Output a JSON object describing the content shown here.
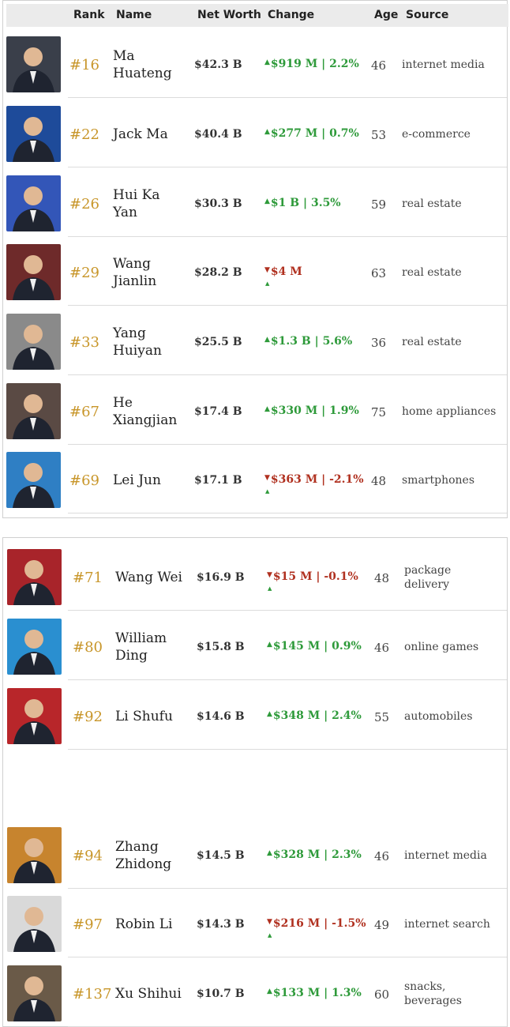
{
  "header": {
    "rank": "Rank",
    "name": "Name",
    "net_worth": "Net Worth",
    "change": "Change",
    "age": "Age",
    "source": "Source"
  },
  "panel1": [
    {
      "rank": "#16",
      "name": [
        "Ma",
        "Huateng"
      ],
      "net_worth": "$42.3 B",
      "change": "$919 M | 2.2%",
      "dir": "up",
      "age": "46",
      "source": [
        "internet media"
      ],
      "photo_color": "#3a3f4a"
    },
    {
      "rank": "#22",
      "name": [
        "Jack Ma"
      ],
      "net_worth": "$40.4 B",
      "change": "$277 M | 0.7%",
      "dir": "up",
      "age": "53",
      "source": [
        "e-commerce"
      ],
      "photo_color": "#1e4b9a"
    },
    {
      "rank": "#26",
      "name": [
        "Hui Ka",
        "Yan"
      ],
      "net_worth": "$30.3 B",
      "change": "$1 B | 3.5%",
      "dir": "up",
      "age": "59",
      "source": [
        "real estate"
      ],
      "photo_color": "#3356b8"
    },
    {
      "rank": "#29",
      "name": [
        "Wang",
        "Jianlin"
      ],
      "net_worth": "$28.2 B",
      "change": "$4 M",
      "dir": "down",
      "age": "63",
      "source": [
        "real estate"
      ],
      "photo_color": "#6e2a2a"
    },
    {
      "rank": "#33",
      "name": [
        "Yang",
        "Huiyan"
      ],
      "net_worth": "$25.5 B",
      "change": "$1.3 B | 5.6%",
      "dir": "up",
      "age": "36",
      "source": [
        "real estate"
      ],
      "photo_color": "#8a8a8a"
    },
    {
      "rank": "#67",
      "name": [
        "He",
        "Xiangjian"
      ],
      "net_worth": "$17.4 B",
      "change": "$330 M | 1.9%",
      "dir": "up",
      "age": "75",
      "source": [
        "home appliances"
      ],
      "photo_color": "#5a4a44"
    },
    {
      "rank": "#69",
      "name": [
        "Lei Jun"
      ],
      "net_worth": "$17.1 B",
      "change": "$363 M | -2.1%",
      "dir": "down",
      "age": "48",
      "source": [
        "smartphones"
      ],
      "photo_color": "#2f7fc4"
    }
  ],
  "panel2": [
    {
      "rank": "#71",
      "name": [
        "Wang Wei"
      ],
      "net_worth": "$16.9 B",
      "change": "$15 M | -0.1%",
      "dir": "down",
      "age": "48",
      "source": [
        "package",
        "delivery"
      ],
      "photo_color": "#a8242a"
    },
    {
      "rank": "#80",
      "name": [
        "William",
        "Ding"
      ],
      "net_worth": "$15.8 B",
      "change": "$145 M | 0.9%",
      "dir": "up",
      "age": "46",
      "source": [
        "online games"
      ],
      "photo_color": "#2a8fd0"
    },
    {
      "rank": "#92",
      "name": [
        "Li Shufu"
      ],
      "net_worth": "$14.6 B",
      "change": "$348 M | 2.4%",
      "dir": "up",
      "age": "55",
      "source": [
        "automobiles"
      ],
      "photo_color": "#b8262a"
    },
    {
      "rank": "#94",
      "name": [
        "Zhang",
        "Zhidong"
      ],
      "net_worth": "$14.5 B",
      "change": "$328 M | 2.3%",
      "dir": "up",
      "age": "46",
      "source": [
        "internet media"
      ],
      "photo_color": "#c7842e"
    },
    {
      "rank": "#97",
      "name": [
        "Robin Li"
      ],
      "net_worth": "$14.3 B",
      "change": "$216 M | -1.5%",
      "dir": "down",
      "age": "49",
      "source": [
        "internet search"
      ],
      "photo_color": "#d9d9d9"
    },
    {
      "rank": "#137",
      "name": [
        "Xu Shihui"
      ],
      "net_worth": "$10.7 B",
      "change": "$133 M | 1.3%",
      "dir": "up",
      "age": "60",
      "source": [
        "snacks,",
        "beverages"
      ],
      "photo_color": "#6a5a48"
    }
  ]
}
